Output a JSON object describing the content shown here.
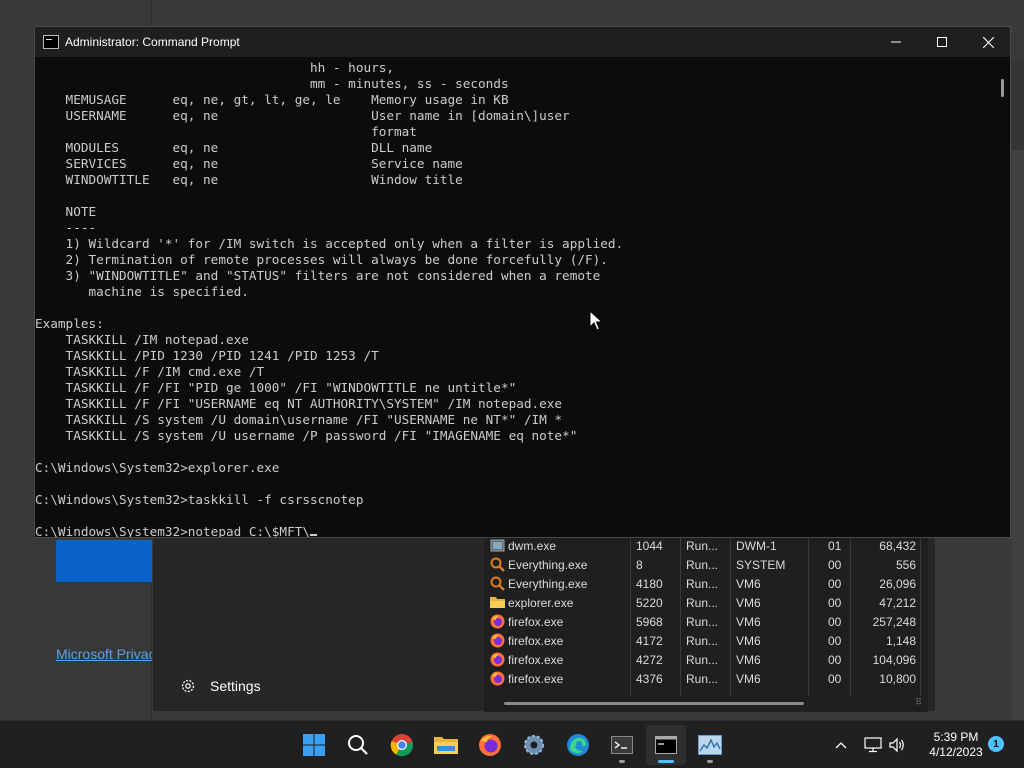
{
  "window": {
    "title": "Administrator: Command Prompt",
    "minimize_glyph": "—",
    "close_glyph": "✕"
  },
  "console_lines": [
    "                                    hh - hours,",
    "                                    mm - minutes, ss - seconds",
    "    MEMUSAGE      eq, ne, gt, lt, ge, le    Memory usage in KB",
    "    USERNAME      eq, ne                    User name in [domain\\]user",
    "                                            format",
    "    MODULES       eq, ne                    DLL name",
    "    SERVICES      eq, ne                    Service name",
    "    WINDOWTITLE   eq, ne                    Window title",
    "",
    "    NOTE",
    "    ----",
    "    1) Wildcard '*' for /IM switch is accepted only when a filter is applied.",
    "    2) Termination of remote processes will always be done forcefully (/F).",
    "    3) \"WINDOWTITLE\" and \"STATUS\" filters are not considered when a remote",
    "       machine is specified.",
    "",
    "Examples:",
    "    TASKKILL /IM notepad.exe",
    "    TASKKILL /PID 1230 /PID 1241 /PID 1253 /T",
    "    TASKKILL /F /IM cmd.exe /T",
    "    TASKKILL /F /FI \"PID ge 1000\" /FI \"WINDOWTITLE ne untitle*\"",
    "    TASKKILL /F /FI \"USERNAME eq NT AUTHORITY\\SYSTEM\" /IM notepad.exe",
    "    TASKKILL /S system /U domain\\username /FI \"USERNAME ne NT*\" /IM *",
    "    TASKKILL /S system /U username /P password /FI \"IMAGENAME eq note*\"",
    "",
    "C:\\Windows\\System32>explorer.exe",
    "",
    "C:\\Windows\\System32>taskkill -f csrsscnotep",
    ""
  ],
  "current_prompt": "C:\\Windows\\System32>notepad C:\\$MFT\\",
  "background": {
    "privacy_link": "Microsoft Privacy",
    "settings_label": "Settings"
  },
  "processes": [
    {
      "name": "dwm.exe",
      "pid": "1044",
      "status": "Run...",
      "user": "DWM-1",
      "cpu": "01",
      "mem": "68,432",
      "icon": "dwm-icon"
    },
    {
      "name": "Everything.exe",
      "pid": "8",
      "status": "Run...",
      "user": "SYSTEM",
      "cpu": "00",
      "mem": "556",
      "icon": "everything-icon"
    },
    {
      "name": "Everything.exe",
      "pid": "4180",
      "status": "Run...",
      "user": "VM6",
      "cpu": "00",
      "mem": "26,096",
      "icon": "everything-icon"
    },
    {
      "name": "explorer.exe",
      "pid": "5220",
      "status": "Run...",
      "user": "VM6",
      "cpu": "00",
      "mem": "47,212",
      "icon": "folder-icon"
    },
    {
      "name": "firefox.exe",
      "pid": "5968",
      "status": "Run...",
      "user": "VM6",
      "cpu": "00",
      "mem": "257,248",
      "icon": "firefox-icon"
    },
    {
      "name": "firefox.exe",
      "pid": "4172",
      "status": "Run...",
      "user": "VM6",
      "cpu": "00",
      "mem": "1,148",
      "icon": "firefox-icon"
    },
    {
      "name": "firefox.exe",
      "pid": "4272",
      "status": "Run...",
      "user": "VM6",
      "cpu": "00",
      "mem": "104,096",
      "icon": "firefox-icon"
    },
    {
      "name": "firefox.exe",
      "pid": "4376",
      "status": "Run...",
      "user": "VM6",
      "cpu": "00",
      "mem": "10,800",
      "icon": "firefox-icon"
    }
  ],
  "taskbar": {
    "apps": [
      {
        "name": "start-button",
        "icon": "windows-logo-icon"
      },
      {
        "name": "search-button",
        "icon": "search-icon"
      },
      {
        "name": "chrome-button",
        "icon": "chrome-icon"
      },
      {
        "name": "file-explorer-button",
        "icon": "folder-icon"
      },
      {
        "name": "firefox-button",
        "icon": "firefox-icon"
      },
      {
        "name": "settings-button",
        "icon": "gear-icon"
      },
      {
        "name": "edge-button",
        "icon": "edge-icon"
      },
      {
        "name": "terminal-button",
        "icon": "terminal-icon"
      },
      {
        "name": "command-prompt-button",
        "icon": "cmd-icon"
      },
      {
        "name": "task-manager-button",
        "icon": "task-manager-icon"
      }
    ],
    "time": "5:39 PM",
    "date": "4/12/2023",
    "notification_count": "1"
  },
  "colors": {
    "console_bg": "#0c0c0c",
    "console_text": "#cccccc",
    "accent": "#4cc2ff",
    "taskbar_bg": "#202020"
  }
}
